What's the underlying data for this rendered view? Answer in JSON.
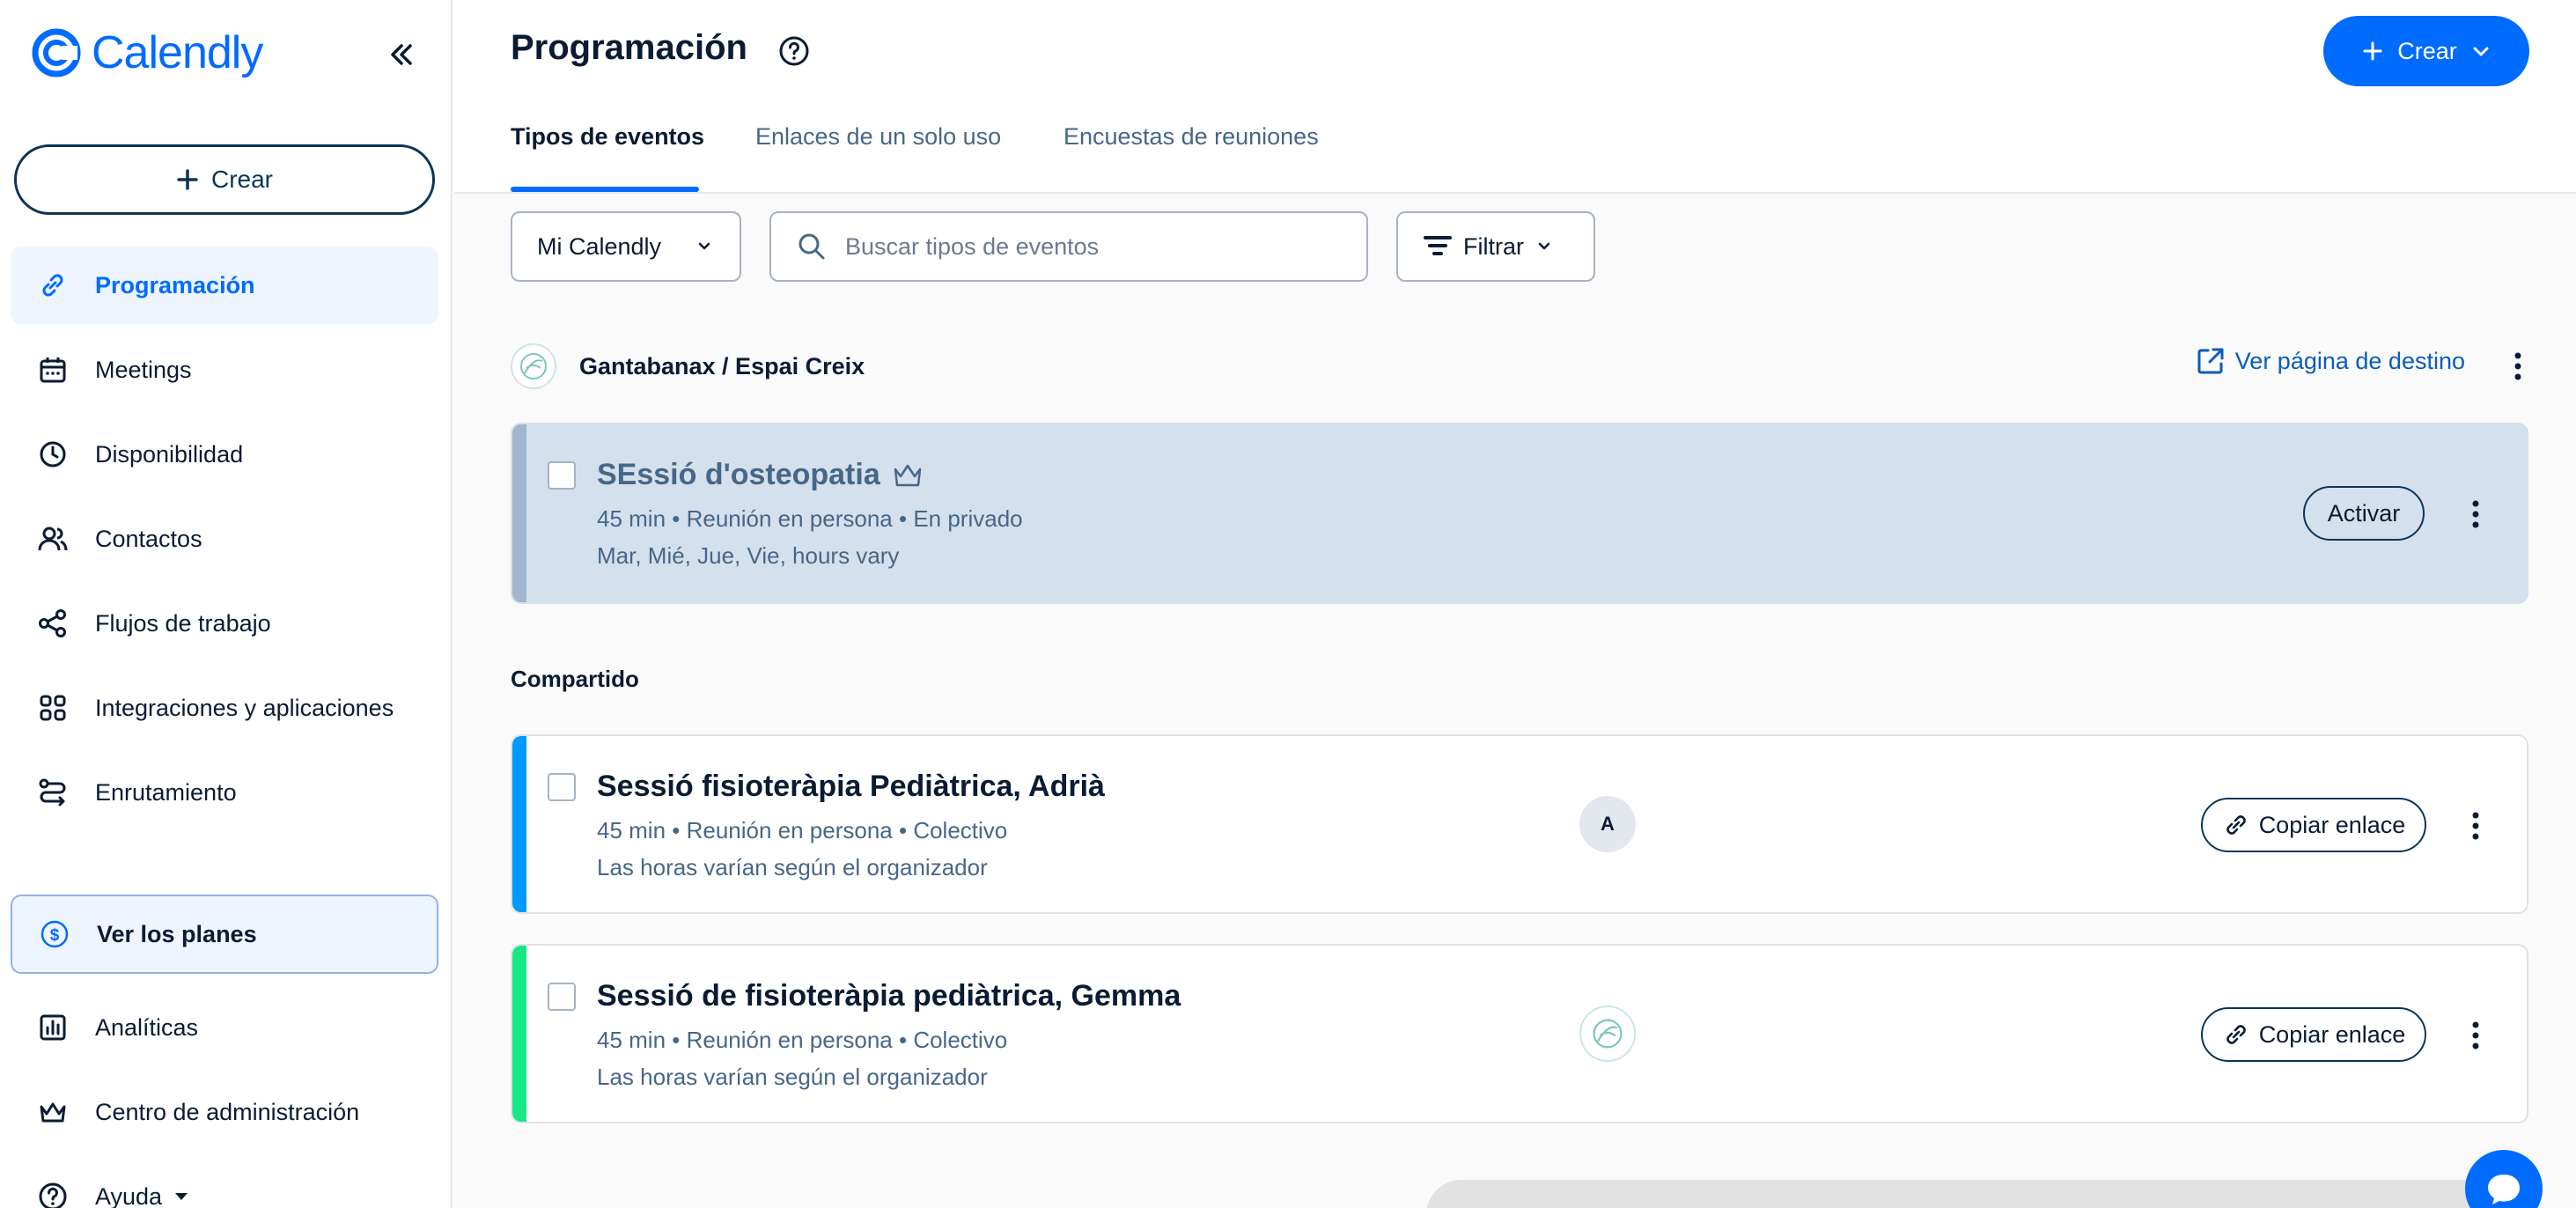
{
  "app": {
    "name": "Calendly"
  },
  "sidebar": {
    "create_label": "Crear",
    "items": [
      {
        "label": "Programación",
        "icon": "link-icon",
        "active": true
      },
      {
        "label": "Meetings",
        "icon": "calendar-icon"
      },
      {
        "label": "Disponibilidad",
        "icon": "clock-icon"
      },
      {
        "label": "Contactos",
        "icon": "contacts-icon"
      },
      {
        "label": "Flujos de trabajo",
        "icon": "workflow-icon"
      },
      {
        "label": "Integraciones y aplicaciones",
        "icon": "apps-grid-icon"
      },
      {
        "label": "Enrutamiento",
        "icon": "routing-icon"
      }
    ],
    "plans_label": "Ver los planes",
    "bottom_items": [
      {
        "label": "Analíticas",
        "icon": "analytics-icon"
      },
      {
        "label": "Centro de administración",
        "icon": "crown-icon"
      },
      {
        "label": "Ayuda",
        "icon": "help-icon"
      }
    ]
  },
  "header": {
    "title": "Programación",
    "create_label": "Crear",
    "tabs": [
      {
        "label": "Tipos de eventos",
        "active": true
      },
      {
        "label": "Enlaces de un solo uso"
      },
      {
        "label": "Encuestas de reuniones"
      }
    ]
  },
  "filters": {
    "calendar_select": "Mi Calendly",
    "search_placeholder": "Buscar tipos de eventos",
    "filter_label": "Filtrar"
  },
  "org": {
    "name": "Gantabanax / Espai Creix",
    "landing_link": "Ver página de destino"
  },
  "events": {
    "private": {
      "title": "SEssió d'osteopatia",
      "meta": "45 min • Reunión en persona • En privado",
      "hours": "Mar, Mié, Jue, Vie, hours vary",
      "action": "Activar",
      "color": "#a3b6cf"
    },
    "shared_label": "Compartido",
    "shared": [
      {
        "title": "Sessió fisioteràpia Pediàtrica, Adrià",
        "meta": "45 min • Reunión en persona • Colectivo",
        "hours": "Las horas varían según el organizador",
        "host_initial": "A",
        "action": "Copiar enlace",
        "color": "#0099ff"
      },
      {
        "title": "Sessió de fisioteràpia pediàtrica, Gemma",
        "meta": "45 min • Reunión en persona • Colectivo",
        "hours": "Las horas varían según el organizador",
        "action": "Copiar enlace",
        "color": "#17e885"
      }
    ]
  },
  "colors": {
    "accent": "#006bff",
    "navy": "#0b3558"
  }
}
